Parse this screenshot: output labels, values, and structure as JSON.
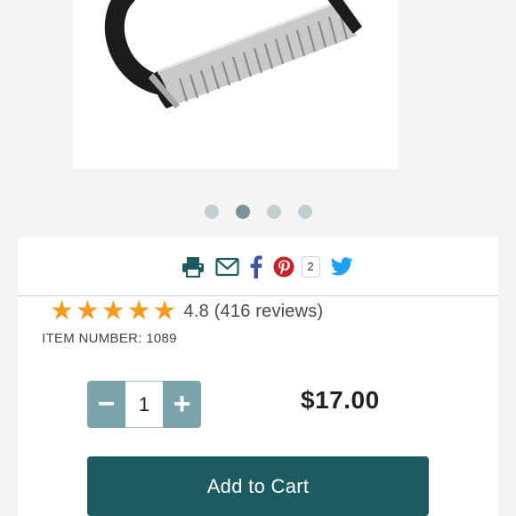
{
  "gallery": {
    "image_alt": "Pastry blender",
    "dot_count": 4,
    "active_dot": 1
  },
  "share": {
    "icons": [
      "print-icon",
      "email-icon",
      "facebook-icon",
      "pinterest-icon",
      "twitter-icon"
    ],
    "pinterest_count": "2"
  },
  "product": {
    "rating_value": 4.8,
    "rating_text": "4.8 (416 reviews)",
    "item_number": "ITEM NUMBER: 1089",
    "quantity": "1",
    "minus_label": "−",
    "plus_label": "+",
    "price": "$17.00",
    "add_to_cart_label": "Add to Cart"
  },
  "colors": {
    "accent": "#1d5b62",
    "stepper": "#7ba4aa",
    "star": "#f39c1f",
    "facebook": "#3b5998",
    "pinterest": "#cb2027",
    "twitter": "#1da1f2"
  }
}
